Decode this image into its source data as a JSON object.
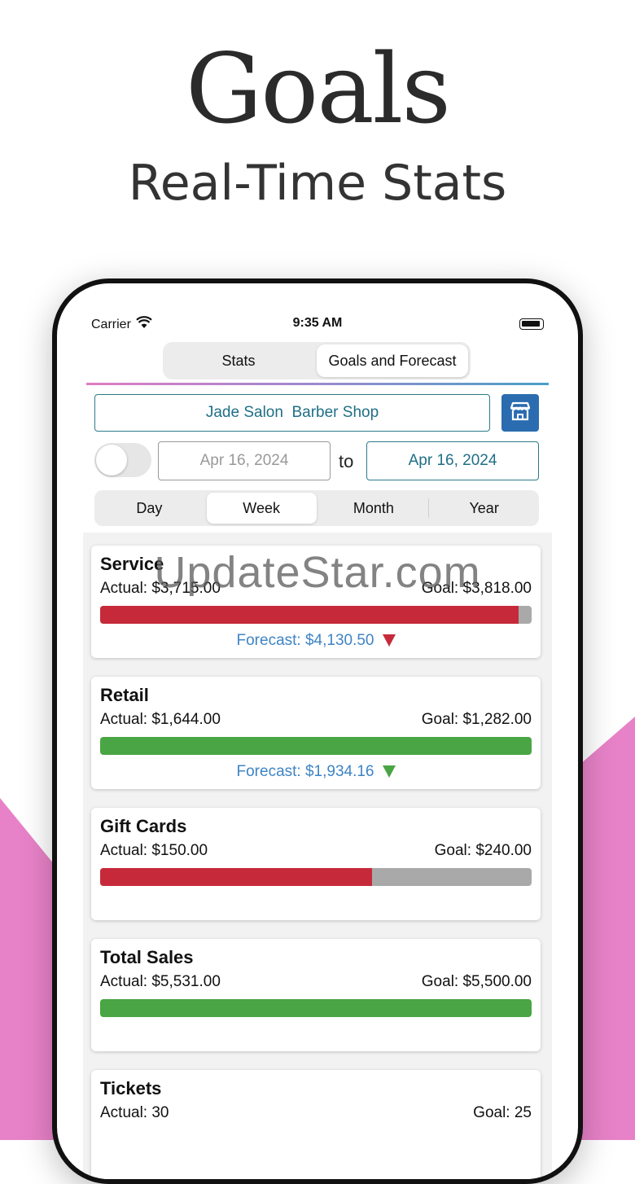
{
  "headline": "Goals",
  "subheadline": "Real-Time Stats",
  "status_bar": {
    "carrier": "Carrier",
    "time": "9:35 AM"
  },
  "top_tabs": [
    {
      "label": "Stats",
      "active": false
    },
    {
      "label": "Goals and Forecast",
      "active": true
    }
  ],
  "store": {
    "name": "Jade Salon  Barber Shop",
    "icon": "store-icon"
  },
  "date_range": {
    "from": "Apr 16, 2024",
    "to_label": "to",
    "to": "Apr 16, 2024"
  },
  "period_tabs": [
    {
      "label": "Day",
      "active": false
    },
    {
      "label": "Week",
      "active": true
    },
    {
      "label": "Month",
      "active": false
    },
    {
      "label": "Year",
      "active": false
    }
  ],
  "colors": {
    "over_goal": "#4aa544",
    "under_goal": "#c62a3a",
    "remaining": "#a9a9a9",
    "forecast_text": "#3f84c4",
    "accent_pink": "#e882c8"
  },
  "cards": [
    {
      "title": "Service",
      "actual": "Actual: $3,715.00",
      "goal": "Goal: $3,818.00",
      "progress": 0.97,
      "status": "under",
      "forecast": "Forecast: $4,130.50",
      "forecast_trend": "down"
    },
    {
      "title": "Retail",
      "actual": "Actual: $1,644.00",
      "goal": "Goal: $1,282.00",
      "progress": 1.0,
      "status": "over",
      "forecast": "Forecast: $1,934.16",
      "forecast_trend": "up"
    },
    {
      "title": "Gift Cards",
      "actual": "Actual: $150.00",
      "goal": "Goal: $240.00",
      "progress": 0.63,
      "status": "under",
      "forecast": "",
      "forecast_trend": ""
    },
    {
      "title": "Total Sales",
      "actual": "Actual: $5,531.00",
      "goal": "Goal: $5,500.00",
      "progress": 1.0,
      "status": "over",
      "forecast": "",
      "forecast_trend": ""
    },
    {
      "title": "Tickets",
      "actual": "Actual: 30",
      "goal": "Goal: 25",
      "progress": null,
      "status": "over",
      "forecast": "",
      "forecast_trend": ""
    }
  ],
  "watermark": "UpdateStar.com"
}
